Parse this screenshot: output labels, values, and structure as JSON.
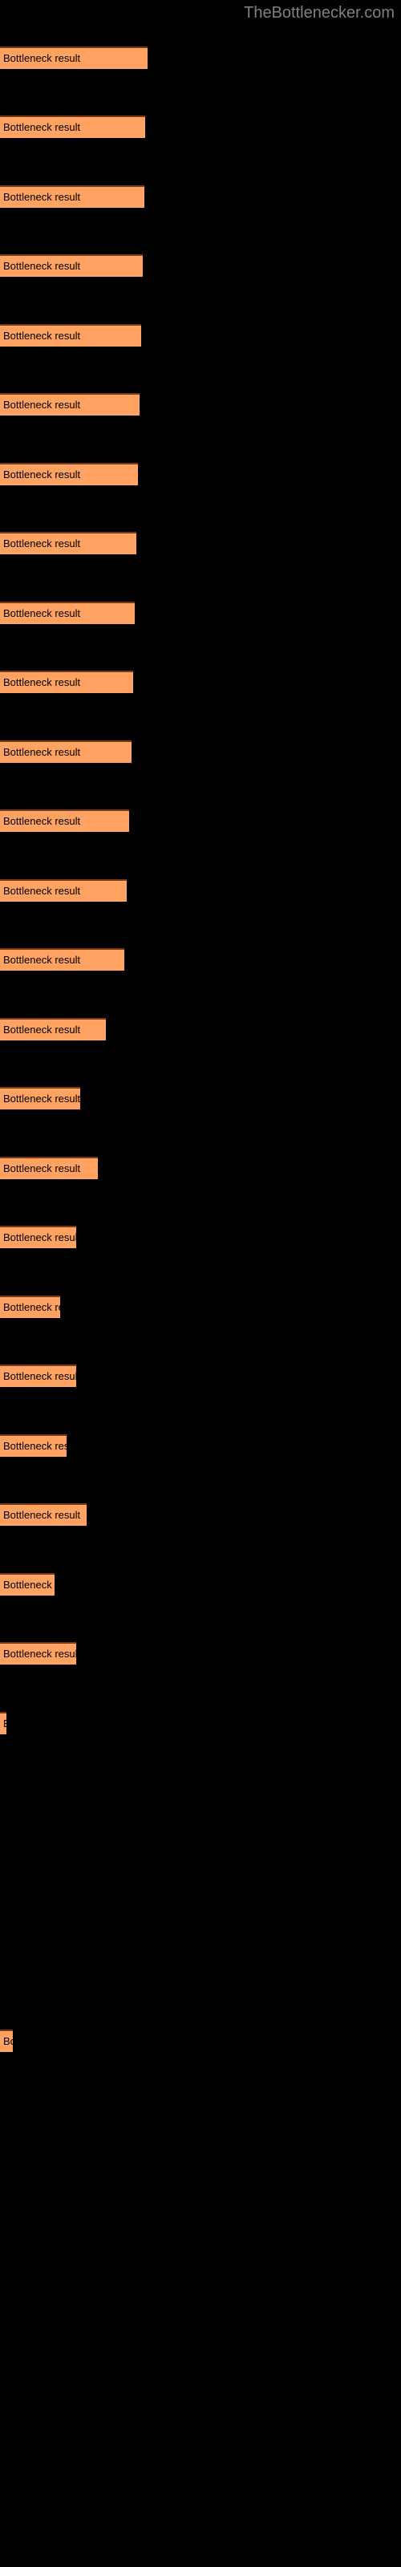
{
  "header": {
    "site_title": "TheBottlenecker.com"
  },
  "colors": {
    "background": "#000000",
    "bar_fill": "#FFA262",
    "bar_border_top": "#7a3b14",
    "title_text": "#808080",
    "bar_text": "#000000"
  },
  "chart_data": {
    "type": "bar",
    "orientation": "horizontal",
    "title": "",
    "xlabel": "",
    "ylabel": "",
    "grid": false,
    "legend": false,
    "bar_label_text": "Bottleneck result",
    "categories": [
      "Bottleneck result",
      "Bottleneck result",
      "Bottleneck result",
      "Bottleneck result",
      "Bottleneck result",
      "Bottleneck result",
      "Bottleneck result",
      "Bottleneck result",
      "Bottleneck result",
      "Bottleneck result",
      "Bottleneck result",
      "Bottleneck result",
      "Bottleneck result",
      "Bottleneck result",
      "Bottleneck result",
      "Bottleneck result",
      "Bottleneck result",
      "Bottleneck result",
      "Bottleneck result",
      "Bottleneck result",
      "Bottleneck result",
      "Bottleneck result",
      "Bottleneck result",
      "Bottleneck result",
      "Bottleneck result",
      "Bottleneck result"
    ],
    "values": [
      184,
      181,
      180,
      178,
      176,
      174,
      172,
      170,
      168,
      166,
      164,
      161,
      158,
      155,
      132,
      100,
      122,
      95,
      75,
      95,
      83,
      108,
      68,
      95,
      8,
      16
    ],
    "xlim": [
      0,
      500
    ],
    "bars": [
      {
        "label": "Bottleneck result",
        "width": 184,
        "top": 58
      },
      {
        "label": "Bottleneck result",
        "width": 181,
        "top": 144
      },
      {
        "label": "Bottleneck result",
        "width": 180,
        "top": 231
      },
      {
        "label": "Bottleneck result",
        "width": 178,
        "top": 317
      },
      {
        "label": "Bottleneck result",
        "width": 176,
        "top": 404
      },
      {
        "label": "Bottleneck result",
        "width": 174,
        "top": 490
      },
      {
        "label": "Bottleneck result",
        "width": 172,
        "top": 577
      },
      {
        "label": "Bottleneck result",
        "width": 170,
        "top": 663
      },
      {
        "label": "Bottleneck result",
        "width": 168,
        "top": 750
      },
      {
        "label": "Bottleneck result",
        "width": 166,
        "top": 836
      },
      {
        "label": "Bottleneck result",
        "width": 164,
        "top": 923
      },
      {
        "label": "Bottleneck result",
        "width": 161,
        "top": 1009
      },
      {
        "label": "Bottleneck result",
        "width": 158,
        "top": 1096
      },
      {
        "label": "Bottleneck result",
        "width": 155,
        "top": 1182
      },
      {
        "label": "Bottleneck result",
        "width": 132,
        "top": 1269
      },
      {
        "label": "Bottleneck result",
        "width": 100,
        "top": 1355
      },
      {
        "label": "Bottleneck result",
        "width": 122,
        "top": 1442
      },
      {
        "label": "Bottleneck result",
        "width": 95,
        "top": 1528
      },
      {
        "label": "Bottleneck result",
        "width": 75,
        "top": 1615
      },
      {
        "label": "Bottleneck result",
        "width": 95,
        "top": 1701
      },
      {
        "label": "Bottleneck result",
        "width": 83,
        "top": 1788
      },
      {
        "label": "Bottleneck result",
        "width": 108,
        "top": 1874
      },
      {
        "label": "Bottleneck result",
        "width": 68,
        "top": 1961
      },
      {
        "label": "Bottleneck result",
        "width": 95,
        "top": 2047
      },
      {
        "label": "Bottleneck result",
        "width": 8,
        "top": 2134
      },
      {
        "label": "Bottleneck result",
        "width": 16,
        "top": 2530
      }
    ]
  }
}
